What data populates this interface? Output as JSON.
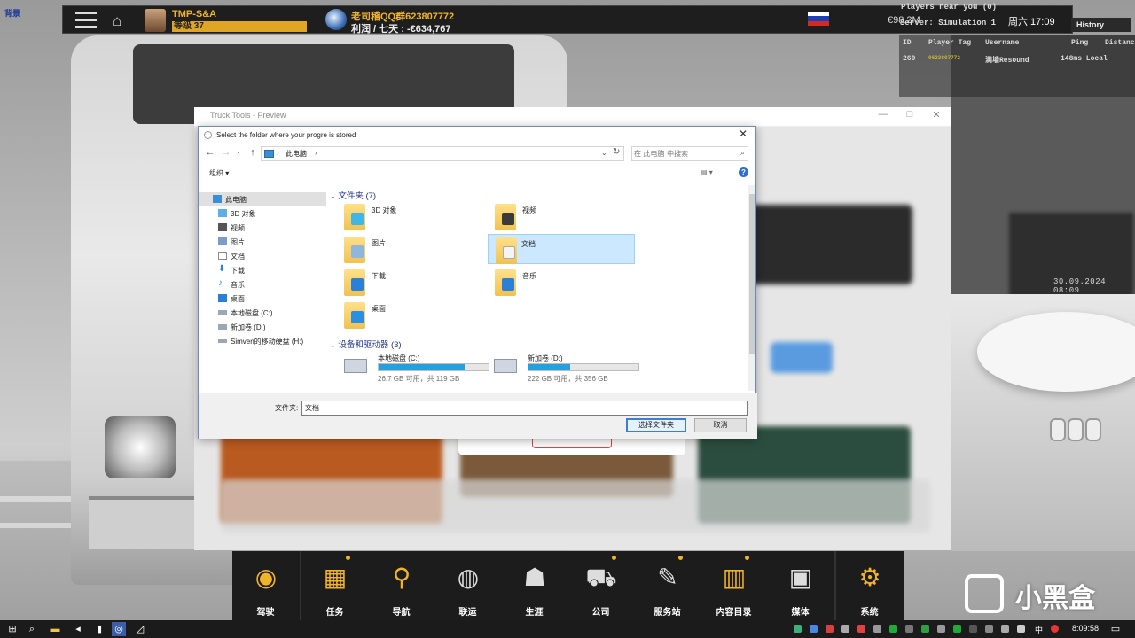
{
  "corner_logo": "背景",
  "hud": {
    "player_name": "TMP-S&A",
    "level": "等级 37",
    "qq_group": "老司稽QQ群623807772",
    "profit": "利润 / 七天 : -€634,767",
    "money": "€98.2M",
    "time": "周六 17:09"
  },
  "players_near": {
    "title": "Players near you (0)",
    "server": "Server: Simulation 1",
    "history_label": "History",
    "headers": [
      "ID",
      "Player Tag",
      "Username",
      "Ping",
      "Distance"
    ],
    "row": [
      "260",
      "0623807772",
      "满墙Resound",
      "148ms Local",
      ""
    ]
  },
  "date_stamp": "30.09.2024 08:09",
  "parent_window": {
    "title": "Truck Tools - Preview",
    "min": "—",
    "max": "□",
    "close": "✕"
  },
  "dialog": {
    "title": "Select the folder where your progre is stored",
    "close": "✕",
    "address_label": "此电脑",
    "address_chevron": "›",
    "nav_back": "←",
    "nav_forward": "→",
    "nav_recent": "⌄",
    "nav_up": "↑",
    "address_dropdown": "⌄",
    "refresh": "↻",
    "search_placeholder": "在 此电脑 中搜索",
    "organize": "组织 ▾",
    "view": "▤ ▾",
    "help": "?",
    "nav_pane": [
      {
        "label": "此电脑",
        "color": "#3b8ed6"
      },
      {
        "label": "3D 对象",
        "color": "#5ab0e6"
      },
      {
        "label": "视频",
        "color": "#555555"
      },
      {
        "label": "图片",
        "color": "#7a9cc6"
      },
      {
        "label": "文档",
        "color": "#8a8a8a"
      },
      {
        "label": "下载",
        "color": "#2a7fd6"
      },
      {
        "label": "音乐",
        "color": "#2a7fd6"
      },
      {
        "label": "桌面",
        "color": "#2a7fd6"
      },
      {
        "label": "本地磁盘 (C:)",
        "color": "#9aa7b5"
      },
      {
        "label": "新加卷 (D:)",
        "color": "#9aa7b5"
      },
      {
        "label": "Simven的移动硬盘 (H:)",
        "color": "#9aa7b5"
      }
    ],
    "folders_header": "文件夹 (7)",
    "folders": [
      {
        "label": "3D 对象",
        "badge": "#3fb6e8"
      },
      {
        "label": "视频",
        "badge": "#3a3a3a"
      },
      {
        "label": "图片",
        "badge": "#8fb6dd"
      },
      {
        "label": "文档",
        "badge": "#f4f4f4"
      },
      {
        "label": "下载",
        "badge": "#2a7fd6"
      },
      {
        "label": "音乐",
        "badge": "#2a7fd6"
      },
      {
        "label": "桌面",
        "badge": "#2a8fe0"
      }
    ],
    "drives_header": "设备和驱动器 (3)",
    "drives": [
      {
        "label": "本地磁盘 (C:)",
        "used_fraction": 0.78,
        "free": "26.7 GB 可用，共 119 GB"
      },
      {
        "label": "新加卷 (D:)",
        "used_fraction": 0.38,
        "free": "222 GB 可用，共 356 GB"
      }
    ],
    "filename_label": "文件夹:",
    "filename_value": "文档",
    "select_button": "选择文件夹",
    "cancel_button": "取消"
  },
  "dock": [
    {
      "label": "驾驶",
      "icon": "◉",
      "dot": false
    },
    {
      "label": "任务",
      "icon": "▦",
      "dot": true
    },
    {
      "label": "导航",
      "icon": "⚲",
      "dot": false
    },
    {
      "label": "联运",
      "icon": "◍",
      "dot": false
    },
    {
      "label": "生涯",
      "icon": "☗",
      "dot": false
    },
    {
      "label": "公司",
      "icon": "⛟",
      "dot": true
    },
    {
      "label": "服务站",
      "icon": "✎",
      "dot": true
    },
    {
      "label": "内容目录",
      "icon": "▥",
      "dot": true
    },
    {
      "label": "媒体",
      "icon": "▣",
      "dot": false
    },
    {
      "label": "系统",
      "icon": "⚙",
      "dot": false
    }
  ],
  "watermark": "小黑盒",
  "taskbar": {
    "ime": "中",
    "clock": "8:09:58"
  },
  "colors": {
    "hud_gold": "#f0b429",
    "dialog_border": "#6a8bbf",
    "selection": "#cce8ff",
    "drive_bar": "#26a0da",
    "group_header": "#1e3287"
  }
}
